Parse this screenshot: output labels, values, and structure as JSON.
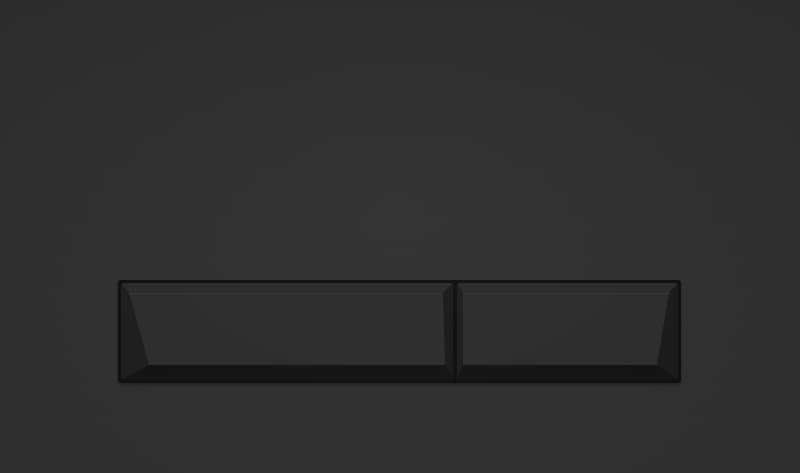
{
  "scene": {
    "description_free": true
  },
  "colors": {
    "wall": "#303030",
    "frame": "#0f0f0f",
    "face": "#2d2d2d",
    "bevel_top": "#2a2a2a",
    "bevel_side_left": "#1f1f1f",
    "bevel_side_right": "#1c1c1c",
    "bevel_bottom": "#141414"
  },
  "buttons": [
    {
      "name": "full-flush-button",
      "icon": "none"
    },
    {
      "name": "half-flush-button",
      "icon": "none"
    }
  ]
}
